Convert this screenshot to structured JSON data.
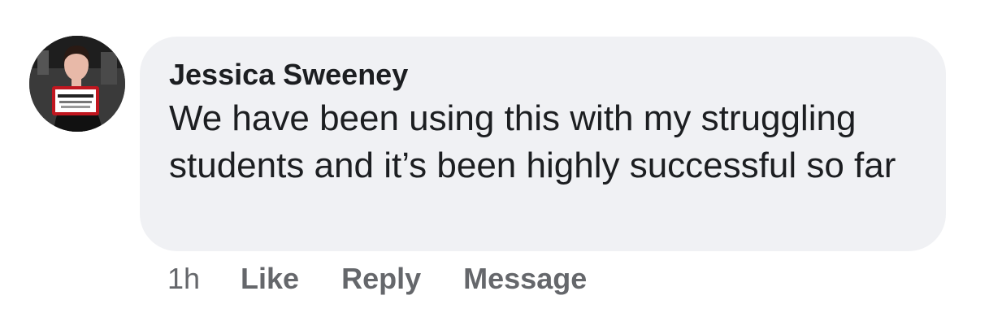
{
  "comment": {
    "author": "Jessica Sweeney",
    "text": "We have been using this with my struggling students and it’s been highly successful so far",
    "avatar_icon": "profile-photo",
    "bubble_color": "#f0f1f4",
    "text_color": "#1c1e21",
    "meta_color": "#65676b"
  },
  "actions": {
    "timestamp": "1h",
    "like_label": "Like",
    "reply_label": "Reply",
    "message_label": "Message"
  }
}
